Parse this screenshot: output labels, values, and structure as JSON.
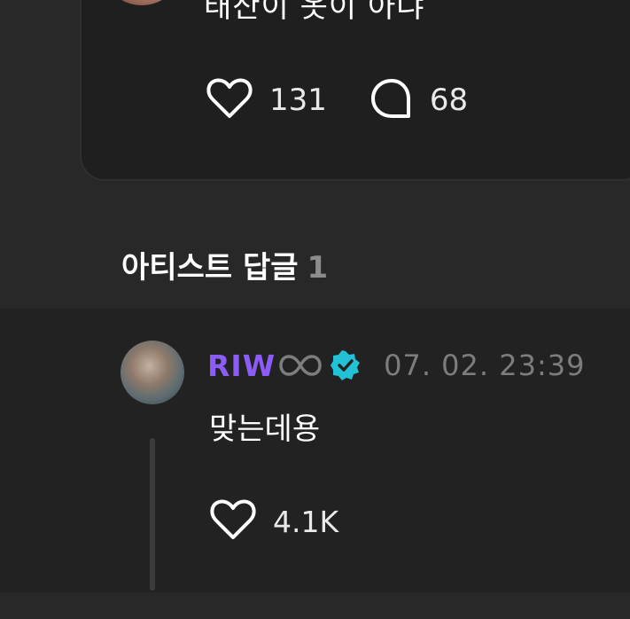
{
  "post": {
    "text": "태산이 옷이 아냐",
    "like_count": "131",
    "comment_count": "68"
  },
  "section": {
    "title": "아티스트 답글",
    "count": "1"
  },
  "reply": {
    "author": "RIW",
    "date": "07. 02. 23:39",
    "text": "맞는데용",
    "like_count": "4.1K",
    "name_color": "#8b5cf6",
    "verified_color": "#22c1d6"
  },
  "icons": {
    "heart": "heart-icon",
    "comment": "comment-icon",
    "infinity": "infinity-icon",
    "verified": "verified-badge-icon"
  }
}
